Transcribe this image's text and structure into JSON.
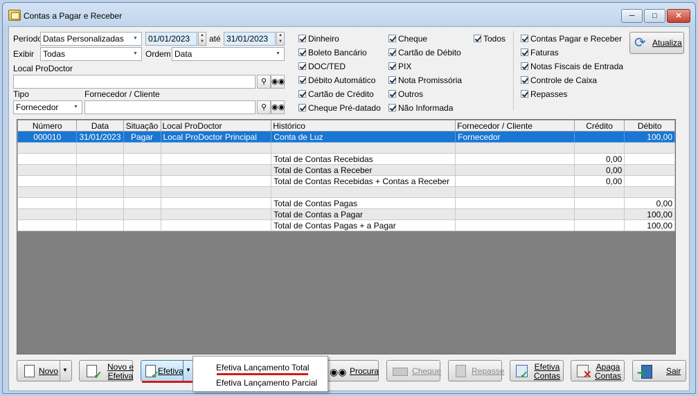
{
  "window": {
    "title": "Contas a Pagar e Receber"
  },
  "filters": {
    "periodo_label": "Período",
    "periodo_value": "Datas Personalizadas",
    "date_from": "01/01/2023",
    "ate_label": "até",
    "date_to": "31/01/2023",
    "exibir_label": "Exibir",
    "exibir_value": "Todas",
    "ordem_label": "Ordem",
    "ordem_value": "Data",
    "local_label": "Local ProDoctor",
    "local_value": "",
    "tipo_label": "Tipo",
    "tipo_value": "Fornecedor",
    "fornecedor_label": "Fornecedor / Cliente",
    "fornecedor_value": ""
  },
  "payment_types": {
    "col1": [
      "Dinheiro",
      "Boleto Bancário",
      "DOC/TED",
      "Débito Automático",
      "Cartão de Crédito",
      "Cheque Pré-datado"
    ],
    "col2": [
      "Cheque",
      "Cartão de Débito",
      "PIX",
      "Nota Promissória",
      "Outros",
      "Não Informada"
    ],
    "todos": "Todos"
  },
  "sources": [
    "Contas Pagar e Receber",
    "Faturas",
    "Notas Fiscais de Entrada",
    "Controle de Caixa",
    "Repasses"
  ],
  "atualiza_label": "Atualiza",
  "grid": {
    "columns": [
      "Número",
      "Data",
      "Situação",
      "Local ProDoctor",
      "Histórico",
      "Fornecedor / Cliente",
      "Crédito",
      "Débito"
    ],
    "rows": [
      [
        "000010",
        "31/01/2023",
        "Pagar",
        "Local ProDoctor Principal",
        "Conta de Luz",
        "Fornecedor",
        "",
        "100,00"
      ],
      [
        "",
        "",
        "",
        "",
        "",
        "",
        "",
        ""
      ],
      [
        "",
        "",
        "",
        "",
        "Total de Contas Recebidas",
        "",
        "0,00",
        ""
      ],
      [
        "",
        "",
        "",
        "",
        "Total de Contas a Receber",
        "",
        "0,00",
        ""
      ],
      [
        "",
        "",
        "",
        "",
        "Total de Contas Recebidas + Contas a Receber",
        "",
        "0,00",
        ""
      ],
      [
        "",
        "",
        "",
        "",
        "",
        "",
        "",
        ""
      ],
      [
        "",
        "",
        "",
        "",
        "Total de Contas Pagas",
        "",
        "",
        "0,00"
      ],
      [
        "",
        "",
        "",
        "",
        "Total de Contas a Pagar",
        "",
        "",
        "100,00"
      ],
      [
        "",
        "",
        "",
        "",
        "Total de Contas Pagas + a Pagar",
        "",
        "",
        "100,00"
      ]
    ]
  },
  "toolbar": {
    "novo": "Novo",
    "novo_efetiva_1": "Novo e",
    "novo_efetiva_2": "Efetiva",
    "efetiva": "Efetiva",
    "procura": "Procura",
    "cheque": "Cheque",
    "repasse": "Repasse",
    "efetiva_contas_1": "Efetiva",
    "efetiva_contas_2": "Contas",
    "apaga_contas_1": "Apaga",
    "apaga_contas_2": "Contas",
    "sair": "Sair"
  },
  "menu": {
    "item_total": "Efetiva Lançamento Total",
    "item_parcial": "Efetiva Lançamento Parcial"
  },
  "colors": {
    "selection": "#1976d2",
    "highlight": "#d11a1a",
    "date_field": "#dceeff"
  }
}
